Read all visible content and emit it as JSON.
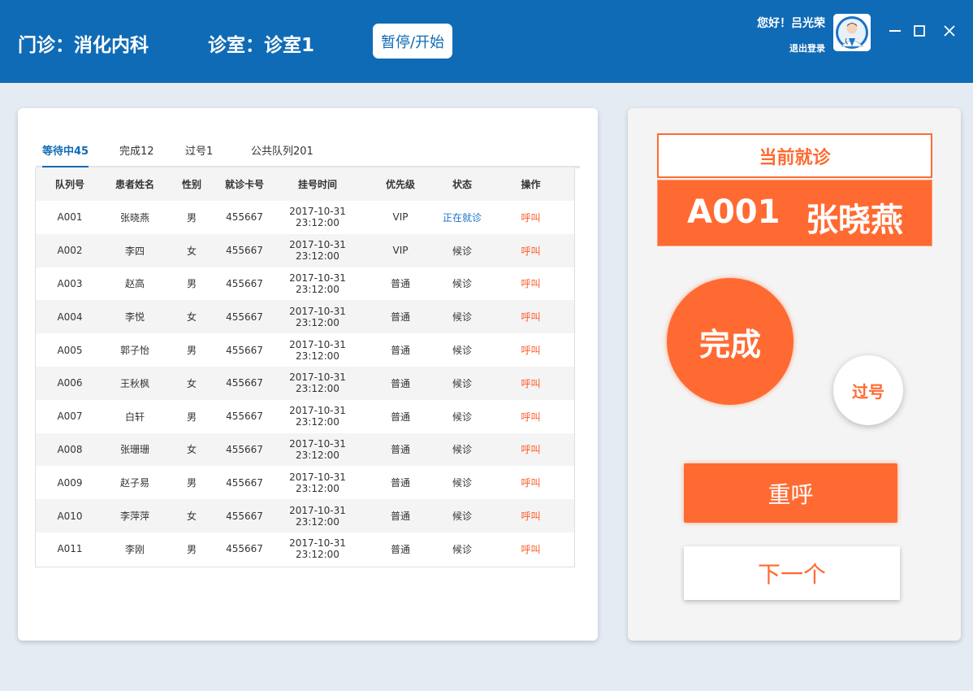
{
  "header": {
    "department": "门诊：消化内科",
    "room": "诊室：诊室1",
    "pause_label": "暂停/开始",
    "greeting": "您好！吕光荣",
    "logout": "退出登录"
  },
  "tabs": [
    {
      "label": "等待中45",
      "active": true
    },
    {
      "label": "完成12",
      "active": false
    },
    {
      "label": "过号1",
      "active": false
    },
    {
      "label": "公共队列201",
      "active": false
    }
  ],
  "table": {
    "columns": [
      "队列号",
      "患者姓名",
      "性别",
      "就诊卡号",
      "挂号时间",
      "优先级",
      "状态",
      "操作"
    ],
    "rows": [
      [
        "A001",
        "张晓燕",
        "男",
        "455667",
        "2017-10-31  23:12:00",
        "VIP",
        "正在就诊",
        "呼叫"
      ],
      [
        "A002",
        "李四",
        "女",
        "455667",
        "2017-10-31  23:12:00",
        "VIP",
        "候诊",
        "呼叫"
      ],
      [
        "A003",
        "赵高",
        "男",
        "455667",
        "2017-10-31  23:12:00",
        "普通",
        "候诊",
        "呼叫"
      ],
      [
        "A004",
        "李悦",
        "女",
        "455667",
        "2017-10-31  23:12:00",
        "普通",
        "候诊",
        "呼叫"
      ],
      [
        "A005",
        "郭子怡",
        "男",
        "455667",
        "2017-10-31  23:12:00",
        "普通",
        "候诊",
        "呼叫"
      ],
      [
        "A006",
        "王秋枫",
        "女",
        "455667",
        "2017-10-31  23:12:00",
        "普通",
        "候诊",
        "呼叫"
      ],
      [
        "A007",
        "白轩",
        "男",
        "455667",
        "2017-10-31  23:12:00",
        "普通",
        "候诊",
        "呼叫"
      ],
      [
        "A008",
        "张珊珊",
        "女",
        "455667",
        "2017-10-31  23:12:00",
        "普通",
        "候诊",
        "呼叫"
      ],
      [
        "A009",
        "赵子易",
        "男",
        "455667",
        "2017-10-31  23:12:00",
        "普通",
        "候诊",
        "呼叫"
      ],
      [
        "A010",
        "李萍萍",
        "女",
        "455667",
        "2017-10-31  23:12:00",
        "普通",
        "候诊",
        "呼叫"
      ],
      [
        "A011",
        "李刚",
        "男",
        "455667",
        "2017-10-31  23:12:00",
        "普通",
        "候诊",
        "呼叫"
      ]
    ]
  },
  "current": {
    "label": "当前就诊",
    "queue_no": "A001",
    "name": "张晓燕"
  },
  "actions": {
    "done": "完成",
    "skip": "过号",
    "recall": "重呼",
    "next": "下一个"
  },
  "colors": {
    "header_blue": "#0f6bb6",
    "accent_orange": "#ff6a32",
    "link_blue": "#1a73c9"
  },
  "icons": {
    "avatar": "doctor-avatar",
    "minimize": "minimize-icon",
    "maximize": "maximize-icon",
    "close": "close-icon"
  }
}
